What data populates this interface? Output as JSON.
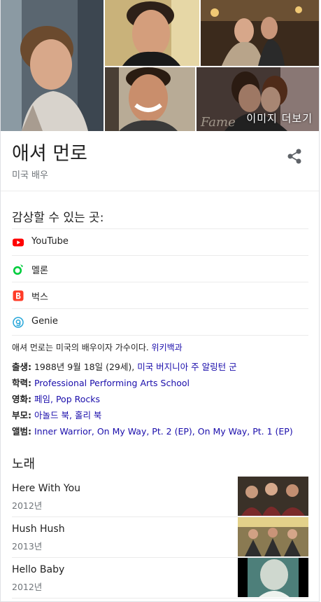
{
  "gallery": {
    "more_images_label": "이미지 더보기"
  },
  "header": {
    "title": "애셔 먼로",
    "subtitle": "미국 배우"
  },
  "watch": {
    "heading": "감상할 수 있는 곳:",
    "items": [
      {
        "label": "YouTube",
        "icon": "youtube-icon",
        "color": "#ff0000"
      },
      {
        "label": "멜론",
        "icon": "melon-icon",
        "color": "#00cd3c"
      },
      {
        "label": "벅스",
        "icon": "bugs-icon",
        "color": "#ff3c28"
      },
      {
        "label": "Genie",
        "icon": "genie-icon",
        "color": "#26a6d9"
      }
    ]
  },
  "description": {
    "text": "애셔 먼로는 미국의 배우이자 가수이다.",
    "source": "위키백과"
  },
  "facts": {
    "born_label": "출생:",
    "born_date": "1988년 9월 18일 (29세),",
    "born_place": "미국 버지니아 주 알링턴 군",
    "education_label": "학력:",
    "education_value": "Professional Performing Arts School",
    "movies_label": "영화:",
    "movie_1": "페임",
    "movie_sep": ",",
    "movie_2": "Pop Rocks",
    "parents_label": "부모:",
    "parent_1": "아놀드 북",
    "parent_sep": ",",
    "parent_2": "홀리 북",
    "albums_label": "앨범:",
    "album_1": "Inner Warrior",
    "album_2": "On My Way, Pt. 2 (EP)",
    "album_3": "On My Way, Pt. 1 (EP)",
    "album_sep": ","
  },
  "songs": {
    "heading": "노래",
    "items": [
      {
        "title": "Here With You",
        "year": "2012년"
      },
      {
        "title": "Hush Hush",
        "year": "2013년"
      },
      {
        "title": "Hello Baby",
        "year": "2012년"
      }
    ]
  },
  "colors": {
    "link": "#1a0dab",
    "secondary": "#70757a",
    "divider": "#ebebeb"
  }
}
